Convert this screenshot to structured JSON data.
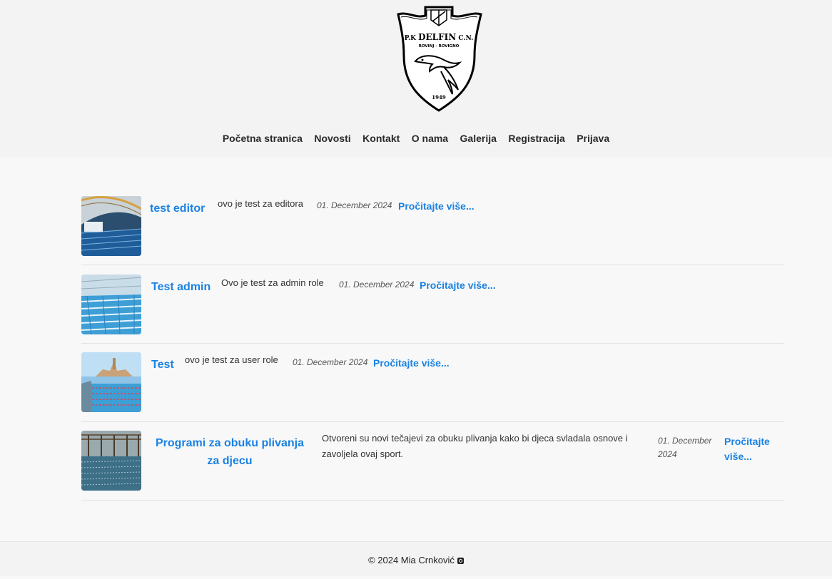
{
  "logo": {
    "line1_left": "P.K",
    "line1_main": "DELFIN",
    "line1_right": "C.N.",
    "line2": "ROVINJ - ROVIGNO",
    "year": "1949"
  },
  "nav": [
    {
      "label": "Početna stranica"
    },
    {
      "label": "Novosti"
    },
    {
      "label": "Kontakt"
    },
    {
      "label": "O nama"
    },
    {
      "label": "Galerija"
    },
    {
      "label": "Registracija"
    },
    {
      "label": "Prijava"
    }
  ],
  "news": [
    {
      "title": "test editor",
      "description": "ovo je test za editora",
      "date": "01. December 2024",
      "read_more": "Pročitajte više..."
    },
    {
      "title": "Test admin",
      "description": "Ovo je test za admin role",
      "date": "01. December 2024",
      "read_more": "Pročitajte više..."
    },
    {
      "title": "Test",
      "description": "ovo je test za user role",
      "date": "01. December 2024",
      "read_more": "Pročitajte više..."
    },
    {
      "title": "Programi za obuku plivanja za djecu",
      "description": "Otvoreni su novi tečajevi za obuku plivanja kako bi djeca svladala osnove i zavoljela ovaj sport.",
      "date": "01. December 2024",
      "read_more": "Pročitajte više..."
    }
  ],
  "footer": {
    "text": "© 2024 Mia Crnković",
    "icon": "instagram-icon"
  },
  "colors": {
    "link": "#1a82e2",
    "header_bg": "#f3f3f3",
    "page_bg": "#f8f8f8"
  }
}
